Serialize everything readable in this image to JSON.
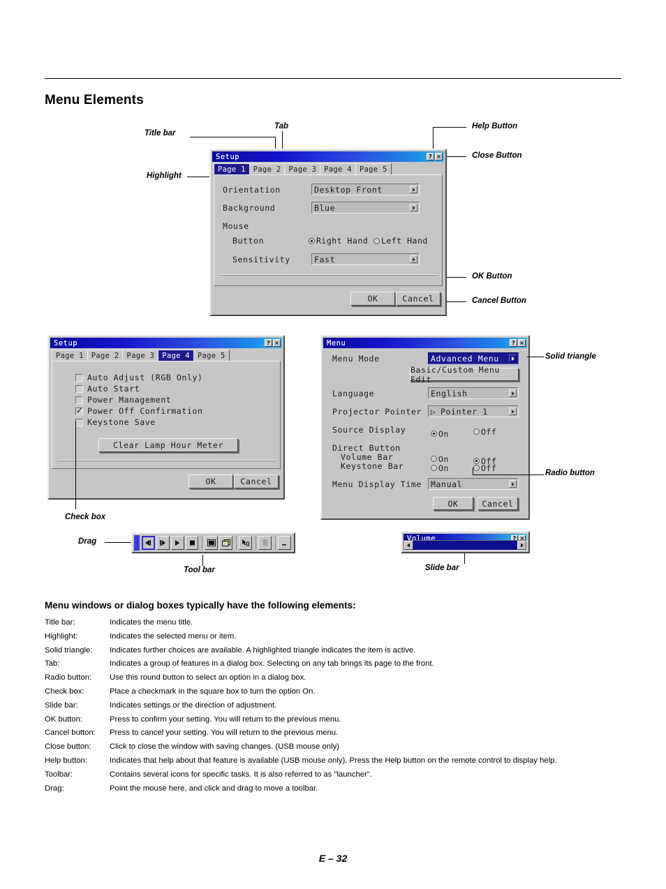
{
  "page": {
    "heading": "Menu Elements",
    "footer": "E – 32"
  },
  "annotations": {
    "title_bar": "Title bar",
    "tab": "Tab",
    "help_button": "Help Button",
    "close_button": "Close Button",
    "highlight": "Highlight",
    "ok_button": "OK Button",
    "cancel_button": "Cancel Button",
    "solid_triangle": "Solid triangle",
    "radio_button": "Radio button",
    "check_box": "Check box",
    "drag": "Drag",
    "tool_bar": "Tool bar",
    "slide_bar": "Slide bar"
  },
  "setup_dialog_1": {
    "title": "Setup",
    "help_label": "?",
    "close_label": "×",
    "tabs": [
      {
        "label": "Page 1",
        "active": true
      },
      {
        "label": "Page 2",
        "active": false
      },
      {
        "label": "Page 3",
        "active": false
      },
      {
        "label": "Page 4",
        "active": false
      },
      {
        "label": "Page 5",
        "active": false
      }
    ],
    "fields": [
      {
        "label": "Orientation",
        "value": "Desktop Front"
      },
      {
        "label": "Background",
        "value": "Blue"
      }
    ],
    "mouse_group_label": "Mouse",
    "mouse_button_label": "Button",
    "mouse_options": [
      {
        "label": "Right Hand",
        "selected": true
      },
      {
        "label": "Left Hand",
        "selected": false
      }
    ],
    "sensitivity_label": "Sensitivity",
    "sensitivity_value": "Fast",
    "ok_label": "OK",
    "cancel_label": "Cancel"
  },
  "setup_dialog_2": {
    "title": "Setup",
    "help_label": "?",
    "close_label": "×",
    "tabs": [
      {
        "label": "Page 1",
        "active": false
      },
      {
        "label": "Page 2",
        "active": false
      },
      {
        "label": "Page 3",
        "active": false
      },
      {
        "label": "Page 4",
        "active": true
      },
      {
        "label": "Page 5",
        "active": false
      }
    ],
    "checkboxes": [
      {
        "label": "Auto Adjust (RGB Only)",
        "checked": false
      },
      {
        "label": "Auto Start",
        "checked": false
      },
      {
        "label": "Power Management",
        "checked": false
      },
      {
        "label": "Power Off Confirmation",
        "checked": true
      },
      {
        "label": "Keystone Save",
        "checked": false
      }
    ],
    "clear_lamp_label": "Clear Lamp Hour Meter",
    "ok_label": "OK",
    "cancel_label": "Cancel"
  },
  "menu_dialog": {
    "title": "Menu",
    "help_label": "?",
    "close_label": "×",
    "menu_mode_label": "Menu Mode",
    "menu_mode_value": "Advanced Menu",
    "basic_custom_label": "Basic/Custom Menu Edit",
    "language_label": "Language",
    "language_value": "English",
    "projector_pointer_label": "Projector Pointer",
    "projector_pointer_value": "Pointer 1",
    "source_display_label": "Source Display",
    "source_display_options": [
      {
        "label": "On",
        "selected": true
      },
      {
        "label": "Off",
        "selected": false
      }
    ],
    "direct_button_label": "Direct Button",
    "volume_bar_label": "Volume Bar",
    "volume_bar_options": [
      {
        "label": "On",
        "selected": false
      },
      {
        "label": "Off",
        "selected": true
      }
    ],
    "keystone_bar_label": "Keystone Bar",
    "keystone_bar_options": [
      {
        "label": "On",
        "selected": false
      },
      {
        "label": "Off",
        "selected": true
      }
    ],
    "menu_display_time_label": "Menu Display Time",
    "menu_display_time_value": "Manual",
    "ok_label": "OK",
    "cancel_label": "Cancel"
  },
  "toolbar": {
    "buttons": [
      {
        "icon": "previous-icon",
        "selected": true
      },
      {
        "icon": "next-icon",
        "selected": false
      },
      {
        "icon": "play-icon",
        "selected": false
      },
      {
        "icon": "stop-icon",
        "selected": false
      },
      {
        "icon": "fullscreen-icon",
        "selected": false
      },
      {
        "icon": "window-icon",
        "selected": false
      },
      {
        "icon": "pointer-icon",
        "selected": false
      },
      {
        "icon": "trash-icon",
        "selected": false
      },
      {
        "icon": "minimize-icon",
        "selected": false
      }
    ]
  },
  "volume_window": {
    "title": "Volume",
    "help_label": "?",
    "close_label": "×",
    "left_arrow": "◀",
    "right_arrow": "▶"
  },
  "definitions": {
    "heading": "Menu windows or dialog boxes typically have the following elements:",
    "items": [
      {
        "term": "Title bar:",
        "desc": "Indicates the menu title."
      },
      {
        "term": "Highlight:",
        "desc": "Indicates the selected menu or item."
      },
      {
        "term": "Solid triangle:",
        "desc": "Indicates further choices are available. A highlighted triangle indicates the item is active."
      },
      {
        "term": "Tab:",
        "desc": "Indicates a group of features in a dialog box. Selecting on any tab brings its page to the front."
      },
      {
        "term": "Radio button:",
        "desc": "Use this round button to select an option in a dialog box."
      },
      {
        "term": "Check box:",
        "desc": "Place a checkmark in the square box to turn the option On."
      },
      {
        "term": "Slide bar:",
        "desc": "Indicates settings or the direction of adjustment."
      },
      {
        "term": "OK button:",
        "desc": "Press to confirm your setting. You will return to the previous menu."
      },
      {
        "term": "Cancel button:",
        "desc": "Press to cancel your setting. You will return to the previous menu."
      },
      {
        "term": "Close button:",
        "desc": "Click to close the window with saving changes. (USB mouse only)"
      },
      {
        "term": "Help button:",
        "desc": "Indicates that help about that feature is available (USB mouse only). Press the Help button on the remote control to display help."
      },
      {
        "term": "Toolbar:",
        "desc": "Contains several icons for specific tasks. It is also referred to as \"launcher\"."
      },
      {
        "term": "Drag:",
        "desc": "Point the mouse here, and click and drag to move a toolbar."
      }
    ]
  },
  "colors": {
    "title_blue": "#1414cc",
    "highlight_navy": "#201a8c",
    "dialog_gray": "#c6c6c6",
    "drag_blue": "#3a3ad8"
  }
}
